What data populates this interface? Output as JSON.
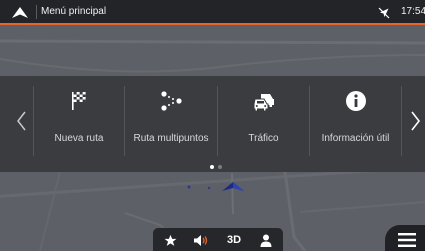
{
  "status_bar": {
    "title": "Menú principal",
    "time": "17:54",
    "icons": {
      "back": "navigation-arrow-icon",
      "gps": "gps-off-icon"
    },
    "accent_color": "#e9642a"
  },
  "main_menu": {
    "items": [
      {
        "label": "Nueva ruta",
        "icon": "checkered-flag-icon"
      },
      {
        "label": "Ruta multipuntos",
        "icon": "multipoint-route-icon"
      },
      {
        "label": "Tráfico",
        "icon": "traffic-car-icon"
      },
      {
        "label": "Información útil",
        "icon": "info-icon"
      }
    ],
    "nav": {
      "prev": "chevron-left-icon",
      "next": "chevron-right-icon"
    },
    "pagination": {
      "pages": 2,
      "current": 1
    }
  },
  "toolbar": {
    "view_mode": "3D",
    "icons": [
      "favorite-star-icon",
      "volume-icon",
      "user-icon"
    ]
  },
  "menu_button": {
    "icon": "hamburger-menu-icon"
  }
}
